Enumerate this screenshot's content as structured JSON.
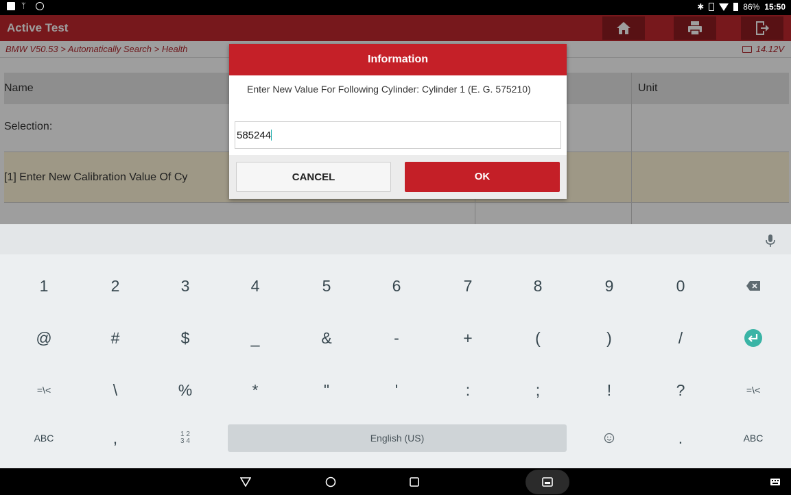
{
  "status_bar": {
    "battery": "86%",
    "time": "15:50"
  },
  "app_header": {
    "title": "Active Test"
  },
  "breadcrumb": {
    "path": "BMW V50.53 > Automatically Search > Health",
    "voltage": "14.12V"
  },
  "table": {
    "headers": [
      "Name",
      "Unit"
    ],
    "rows": [
      "Selection:",
      "[1] Enter New Calibration Value Of Cy"
    ]
  },
  "dialog": {
    "title": "Information",
    "message": "Enter New Value For Following Cylinder: Cylinder 1 (E. G. 575210)",
    "input_value": "585244",
    "cancel_label": "CANCEL",
    "ok_label": "OK"
  },
  "keyboard": {
    "row1": [
      "1",
      "2",
      "3",
      "4",
      "5",
      "6",
      "7",
      "8",
      "9",
      "0"
    ],
    "row2": [
      "@",
      "#",
      "$",
      "_",
      "&",
      "-",
      "+",
      "(",
      ")",
      "/"
    ],
    "row3": [
      "=\\<",
      "\\",
      "%",
      "*",
      "\"",
      "'",
      ":",
      ";",
      "!",
      "?",
      "=\\<"
    ],
    "row4": {
      "left": "ABC",
      "comma": ",",
      "numpad": "1 2\n3 4",
      "space": "English (US)",
      "period": ".",
      "right": "ABC"
    }
  },
  "colors": {
    "brand_red": "#c41f27",
    "keyboard_bg": "#eceff1",
    "accent_teal": "#3ab4a6"
  }
}
